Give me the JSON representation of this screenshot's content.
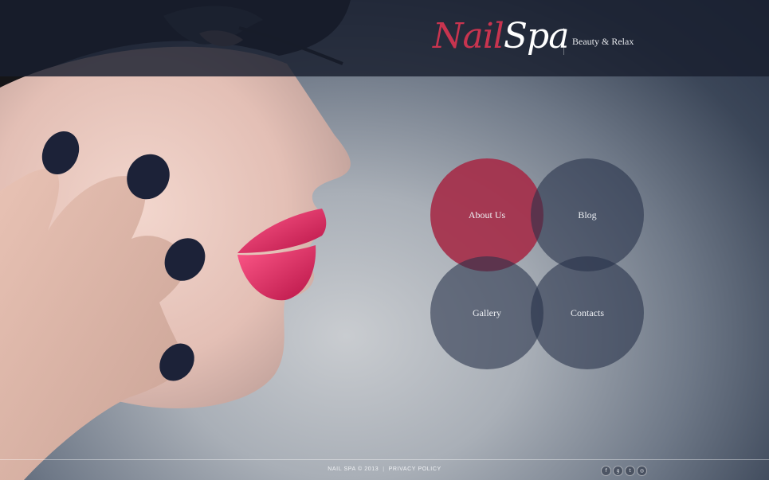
{
  "header": {
    "logo_part_a": "Nail",
    "logo_part_b": "Spa",
    "tagline": "Beauty & Relax"
  },
  "nav": {
    "items": [
      {
        "label": "About Us"
      },
      {
        "label": "Blog"
      },
      {
        "label": "Gallery"
      },
      {
        "label": "Contacts"
      }
    ]
  },
  "footer": {
    "copyright": "NAIL SPA © 2013",
    "separator": "|",
    "privacy": "PRIVACY POLICY"
  },
  "social": {
    "items": [
      {
        "icon": "facebook-icon",
        "glyph": "f"
      },
      {
        "icon": "google-plus-icon",
        "glyph": "g"
      },
      {
        "icon": "twitter-icon",
        "glyph": "t"
      },
      {
        "icon": "dribbble-icon",
        "glyph": "◎"
      }
    ]
  },
  "colors": {
    "accent": "#a52c48",
    "logo_accent": "#c8344f",
    "header": "#181e2e",
    "circle_dark": "#263148"
  }
}
